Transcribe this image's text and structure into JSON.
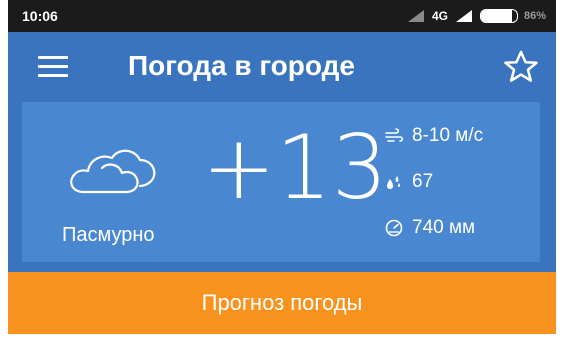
{
  "status_bar": {
    "time": "10:06",
    "network": "4G",
    "battery_text": "86%",
    "battery_level": 0.86
  },
  "app_bar": {
    "title": "Погода в городе",
    "menu_icon": "menu-icon",
    "favorite_icon": "star-outline-icon"
  },
  "weather": {
    "condition": "Пасмурно",
    "condition_icon": "cloud-icon",
    "temperature": "+13",
    "wind": "8-10 м/с",
    "humidity": "67",
    "pressure": "740 мм"
  },
  "forecast_button": {
    "label": "Прогноз погоды"
  },
  "colors": {
    "status_bar": "#1b1b1b",
    "app_blue": "#3a74bf",
    "card_blue": "#4a87d1",
    "accent_orange": "#f7931e"
  }
}
